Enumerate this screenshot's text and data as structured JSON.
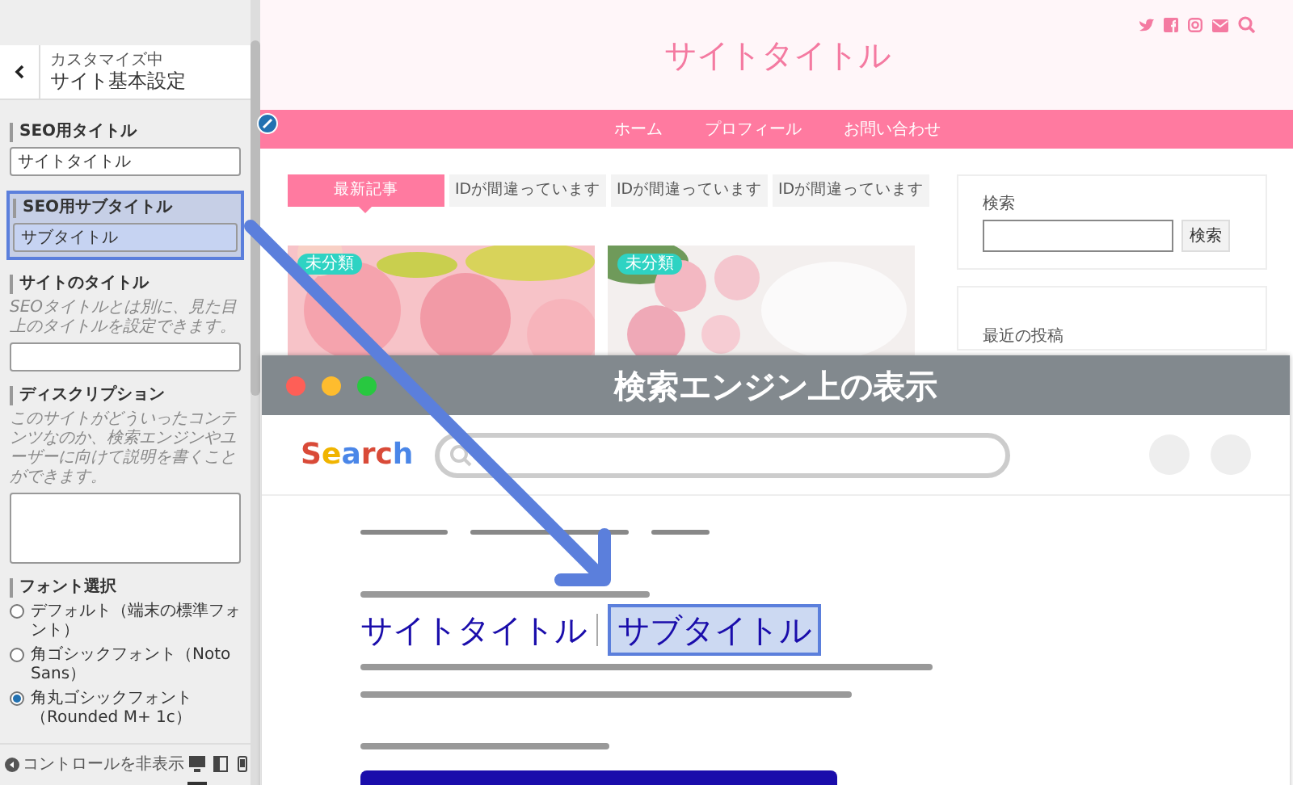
{
  "sidebar": {
    "header": {
      "subtitle": "カスタマイズ中",
      "title": "サイト基本設定"
    },
    "sections": [
      {
        "kind": "input",
        "label": "SEO用タイトル",
        "value": "サイトタイトル",
        "highlighted": false
      },
      {
        "kind": "input",
        "label": "SEO用サブタイトル",
        "value": "サブタイトル",
        "highlighted": true
      },
      {
        "kind": "input",
        "label": "サイトのタイトル",
        "description": "SEOタイトルとは別に、見た目上のタイトルを設定できます。",
        "highlighted": false
      },
      {
        "kind": "textarea",
        "label": "ディスクリプション",
        "description": "このサイトがどういったコンテンツなのか、検索エンジンやユーザーに向けて説明を書くことができます。",
        "highlighted": false
      },
      {
        "kind": "radio",
        "label": "フォント選択",
        "highlighted": false,
        "options": [
          {
            "label": "デフォルト（端末の標準フォント）",
            "selected": false
          },
          {
            "label": "角ゴシックフォント（Noto Sans）",
            "selected": false
          },
          {
            "label": "角丸ゴシックフォント（Rounded M+ 1c）",
            "selected": true
          }
        ]
      }
    ],
    "footer": {
      "collapse_label": "コントロールを非表示",
      "devices": [
        {
          "kind": "desktop",
          "selected": true
        },
        {
          "kind": "tablet",
          "selected": false
        },
        {
          "kind": "mobile",
          "selected": false
        }
      ]
    }
  },
  "preview": {
    "site_title": "サイトタイトル",
    "nav": [
      "ホーム",
      "プロフィール",
      "お問い合わせ"
    ],
    "tabs": [
      {
        "label": "最新記事",
        "selected": true
      },
      {
        "label": "IDが間違っています",
        "selected": false
      },
      {
        "label": "IDが間違っています",
        "selected": false
      },
      {
        "label": "IDが間違っています",
        "selected": false
      }
    ],
    "posts": [
      {
        "category": "未分類",
        "kind": "picture"
      },
      {
        "category": "未分類",
        "kind": "picture"
      }
    ],
    "search_widget": {
      "title": "検索",
      "button": "検索"
    },
    "recent_widget": {
      "title": "最近の投稿"
    }
  },
  "overlay": {
    "title": "検索エンジン上の表示",
    "logo": "Search",
    "result_title": "サイトタイトル",
    "result_subtitle": "サブタイトル"
  }
}
